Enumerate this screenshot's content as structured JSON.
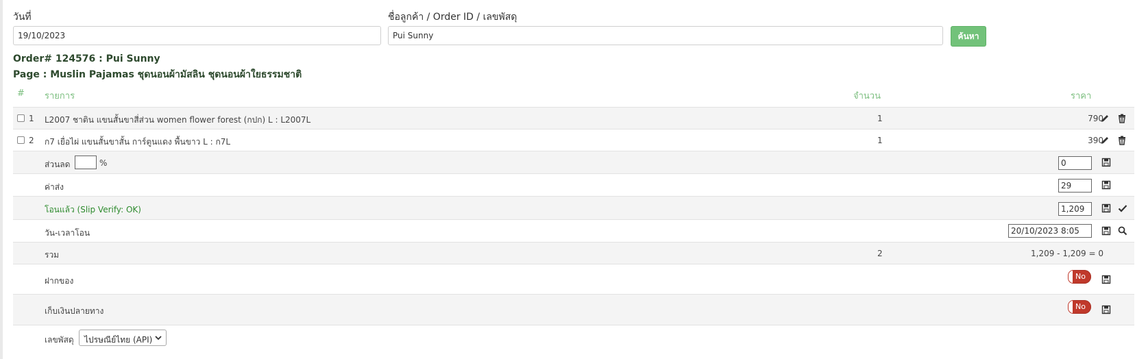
{
  "filters": {
    "date_label": "วันที่",
    "date_value": "19/10/2023",
    "search_label": "ชื่อลูกค้า / Order ID / เลขพัสดุ",
    "search_value": "Pui Sunny",
    "search_button": "ค้นหา"
  },
  "order": {
    "title": "Order# 124576 : Pui Sunny",
    "page": "Page : Muslin Pajamas ชุดนอนผ้ามัสลิน ชุดนอนผ้าใยธรรมชาติ"
  },
  "table": {
    "headers": {
      "num": "#",
      "item": "รายการ",
      "qty": "จำนวน",
      "price": "ราคา"
    },
    "items": [
      {
        "num": "1",
        "desc": "L2007 ชาติน แขนสั้นขาสี่ส่วน women flower forest (กปก) L : L2007L",
        "qty": "1",
        "price": "790"
      },
      {
        "num": "2",
        "desc": "ก7 เยื่อไผ่ แขนสั้นขาสั้น การ์ตูนแดง พื้นขาว L : ก7L",
        "qty": "1",
        "price": "390"
      }
    ],
    "discount": {
      "label": "ส่วนลด",
      "percent_value": "",
      "percent_sign": "%",
      "value": "0"
    },
    "shipping": {
      "label": "ค่าส่ง",
      "value": "29"
    },
    "transferred": {
      "label": "โอนแล้ว",
      "status": "(Slip Verify: OK)",
      "value": "1,209"
    },
    "transfer_time": {
      "label": "วัน-เวลาโอน",
      "value": "20/10/2023 8:05"
    },
    "total": {
      "label": "รวม",
      "qty": "2",
      "calc": "1,209 - 1,209 = 0"
    },
    "deposit": {
      "label": "ฝากของ",
      "toggle": "No"
    },
    "cod": {
      "label": "เก็บเงินปลายทาง",
      "toggle": "No"
    },
    "tracking": {
      "label": "เลขพัสดุ",
      "carrier": "ไปรษณีย์ไทย (API)"
    }
  },
  "colors": {
    "accent_green": "#72c27a",
    "header_green": "#7dbf80",
    "status_green": "#2e8b2e",
    "toggle_red": "#c0392b"
  }
}
